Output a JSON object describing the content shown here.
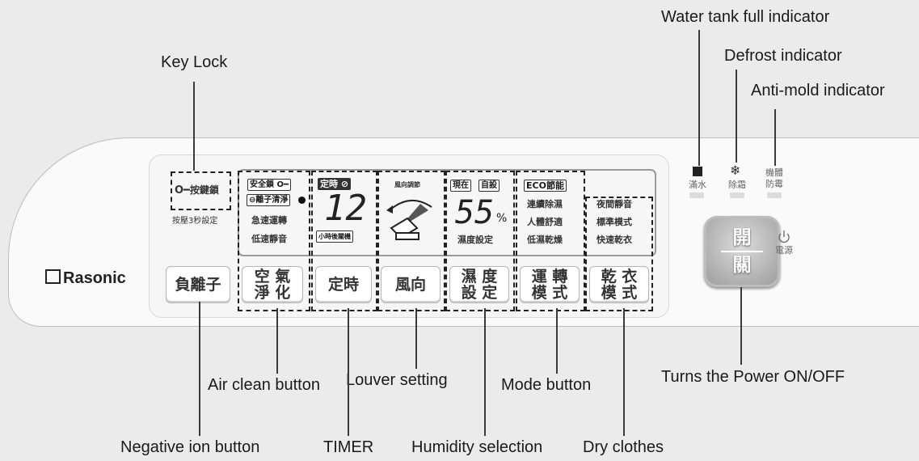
{
  "callouts": {
    "water_tank": "Water tank full indicator",
    "defrost": "Defrost indicator",
    "anti_mold": "Anti-mold indicator",
    "key_lock": "Key Lock",
    "air_clean": "Air clean button",
    "louver": "Louver setting",
    "mode": "Mode button",
    "power": "Turns the Power ON/OFF",
    "negative_ion": "Negative ion button",
    "timer": "TIMER",
    "humidity": "Humidity selection",
    "dry_clothes": "Dry clothes"
  },
  "brand": "Rasonic",
  "keylock": {
    "label": "按鍵鎖",
    "sub": "按壓3秒設定"
  },
  "screen": {
    "safety_lock": "安全鎖",
    "ion_clean": "離子清淨",
    "fast_run": "急速運轉",
    "quiet": "低速靜音",
    "timer_label": "定時",
    "timer_value": "12",
    "timer_sub": "小時後關機",
    "louver_label": "風向調節",
    "now": "現在",
    "custom": "自設",
    "humidity_value": "55",
    "humidity_unit": "%",
    "humidity_label": "濕度設定",
    "eco": "ECO節能",
    "continuous": "連續除濕",
    "comfort": "人體舒適",
    "low_dry": "低濕乾燥",
    "night": "夜間靜音",
    "standard": "標準模式",
    "fast_dry": "快速乾衣"
  },
  "buttons": {
    "negative_ion": "負離子",
    "air_clean_1": "空 氣",
    "air_clean_2": "淨 化",
    "timer": "定時",
    "louver": "風向",
    "humidity_1": "濕 度",
    "humidity_2": "設 定",
    "mode_1": "運 轉",
    "mode_2": "模 式",
    "dry_1": "乾 衣",
    "dry_2": "模 式"
  },
  "indicators": {
    "water_1": "滿水",
    "defrost_1": "除霜",
    "mold_1": "機體",
    "mold_2": "防霉"
  },
  "power": {
    "top": "開",
    "bottom": "關",
    "label": "電源",
    "icon": "power-icon"
  }
}
